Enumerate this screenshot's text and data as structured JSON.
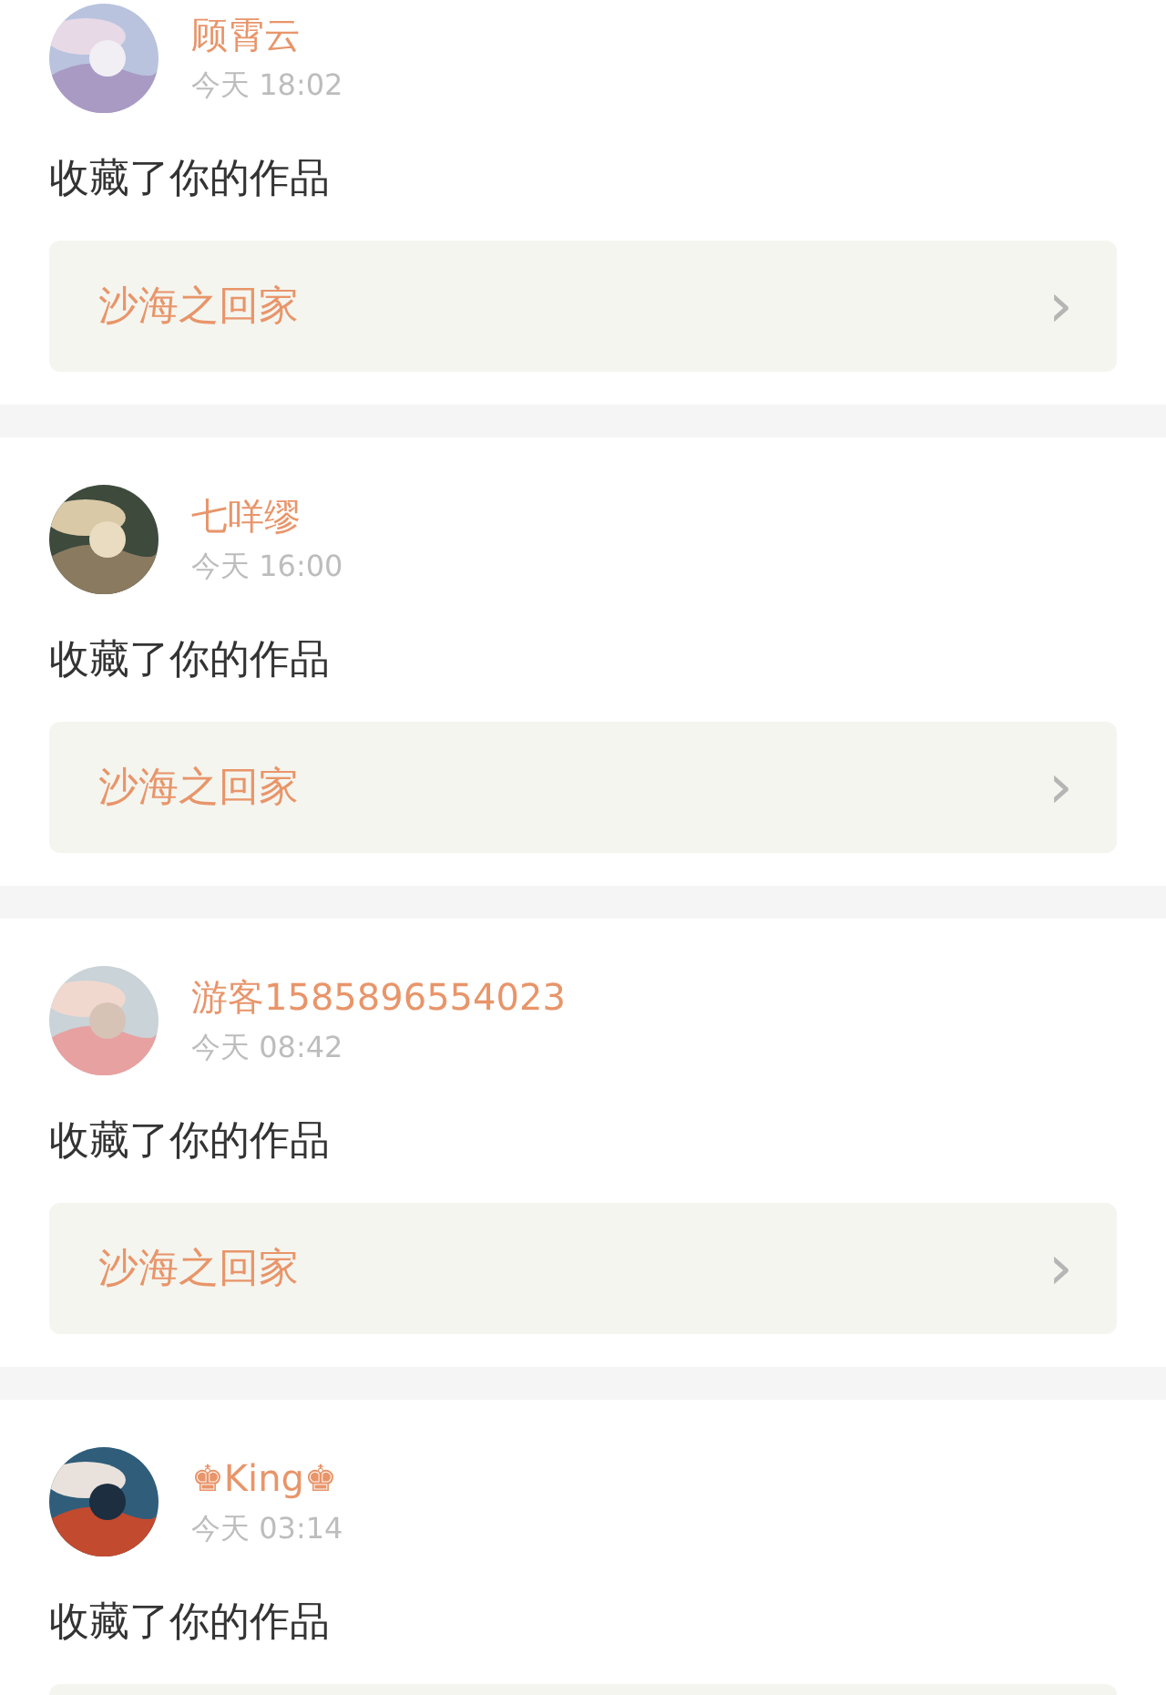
{
  "notifications": [
    {
      "user": "顾霄云",
      "time": "今天 18:02",
      "action": "收藏了你的作品",
      "work": "沙海之回家",
      "chevron": "›"
    },
    {
      "user": "七咩缪",
      "time": "今天 16:00",
      "action": "收藏了你的作品",
      "work": "沙海之回家",
      "chevron": "›"
    },
    {
      "user": "游客1585896554023",
      "time": "今天 08:42",
      "action": "收藏了你的作品",
      "work": "沙海之回家",
      "chevron": "›"
    },
    {
      "user": "♚King♚",
      "time": "今天 03:14",
      "action": "收藏了你的作品"
    }
  ]
}
